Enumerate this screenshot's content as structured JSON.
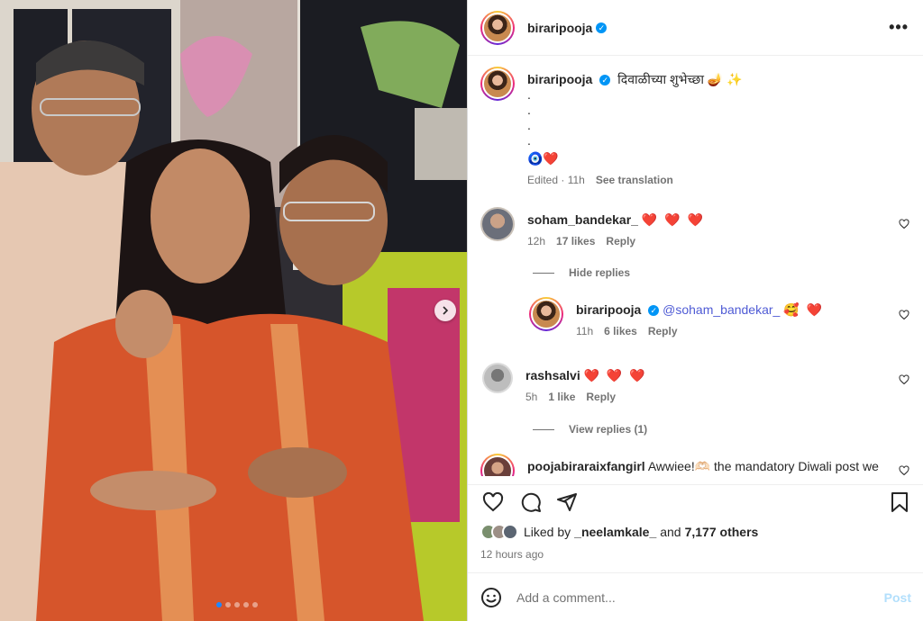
{
  "post": {
    "username": "biraripooja",
    "more_icon": "more-horizontal-icon",
    "carousel": {
      "dot_count": 5,
      "active_index": 0
    }
  },
  "caption": {
    "username": "biraripooja",
    "text": "दिवाळीच्या शुभेच्छा 🪔 ✨",
    "dot_lines": [
      ".",
      ".",
      ".",
      "."
    ],
    "emojis": "🧿❤️",
    "edited": "Edited · 11h",
    "see_translation": "See translation"
  },
  "comments": [
    {
      "username": "soham_bandekar_",
      "text": "❤️ ❤️ ❤️",
      "time": "12h",
      "likes": "17 likes",
      "reply": "Reply",
      "toggle": "Hide replies"
    },
    {
      "username": "biraripooja",
      "mention": "@soham_bandekar_",
      "text": "🥰 ❤️",
      "time": "11h",
      "likes": "6 likes",
      "reply": "Reply"
    },
    {
      "username": "rashsalvi",
      "text": "❤️ ❤️ ❤️",
      "time": "5h",
      "likes": "1 like",
      "reply": "Reply",
      "toggle": "View replies (1)"
    },
    {
      "username": "poojabiraraixfangirl",
      "text": "Awwiee!🫶🏻 the mandatory Diwali post we"
    }
  ],
  "actions": {
    "like_icon": "heart-icon",
    "comment_icon": "comment-icon",
    "share_icon": "send-icon",
    "save_icon": "bookmark-icon"
  },
  "likes": {
    "prefix": "Liked by",
    "user": "_neelamkale_",
    "middle": "and",
    "others": "7,177 others"
  },
  "time_ago": "12 hours ago",
  "add_comment": {
    "placeholder": "Add a comment...",
    "post_label": "Post",
    "emoji_icon": "emoji-smile-icon"
  }
}
